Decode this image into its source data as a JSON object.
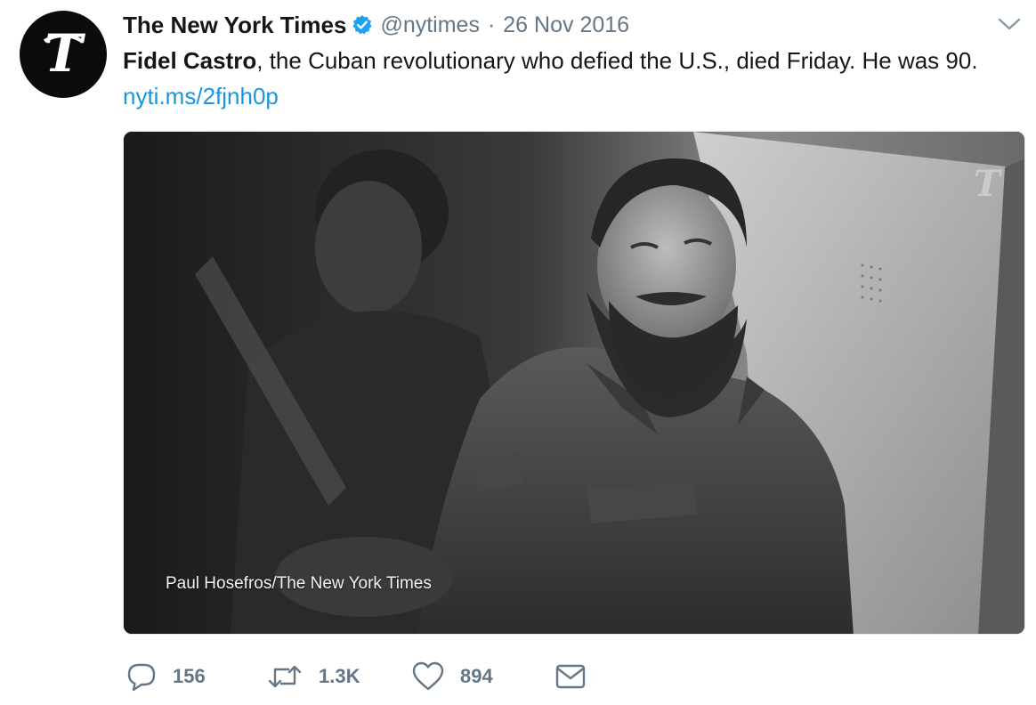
{
  "tweet": {
    "display_name": "The New York Times",
    "handle": "@nytimes",
    "separator": "·",
    "date": "26 Nov 2016",
    "text_bold": "Fidel Castro",
    "text_rest": ", the Cuban revolutionary who defied the U.S., died Friday. He was 90. ",
    "link": "nyti.ms/2fjnh0p",
    "avatar_icon": "nyt-t-logo",
    "verified_icon": "verified-badge-icon",
    "menu_icon": "chevron-down-icon"
  },
  "media": {
    "caption": "Paul Hosefros/The New York Times",
    "watermark_icon": "nyt-t-watermark"
  },
  "actions": {
    "reply": {
      "icon": "reply-bubble-icon",
      "count": "156"
    },
    "retweet": {
      "icon": "retweet-icon",
      "count": "1.3K"
    },
    "like": {
      "icon": "heart-icon",
      "count": "894"
    },
    "message": {
      "icon": "envelope-icon"
    }
  },
  "colors": {
    "text": "#14171a",
    "secondary": "#657786",
    "link": "#1b95e0",
    "verified": "#1da1f2"
  }
}
